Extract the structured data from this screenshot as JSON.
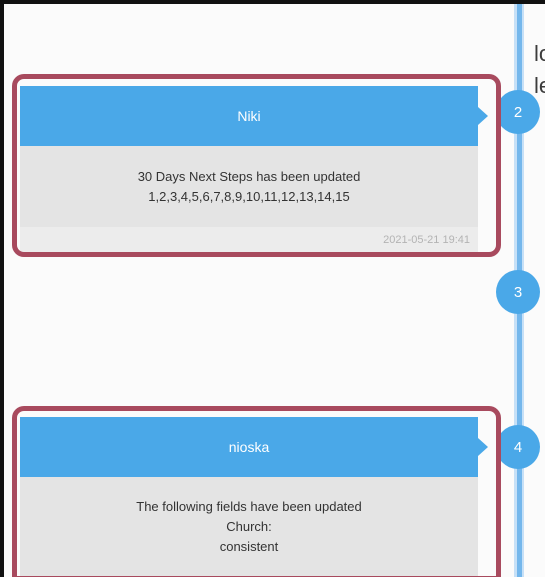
{
  "timeline": {
    "entries": [
      {
        "step": "2",
        "author": "Niki",
        "message_lines": [
          "30 Days Next Steps has been updated",
          "1,2,3,4,5,6,7,8,9,10,11,12,13,14,15"
        ],
        "timestamp": "2021-05-21 19:41"
      },
      {
        "step": "3"
      },
      {
        "step": "4",
        "author": "nioska",
        "message_lines": [
          "The following fields have been updated",
          "Church:",
          "consistent"
        ]
      }
    ],
    "right_edge_fragment": [
      "lo",
      "le"
    ]
  },
  "colors": {
    "accent": "#4aa8e8",
    "highlight_border": "#a84a5e",
    "card_body": "#e4e4e4",
    "timeline_line": "#74b7ec"
  }
}
